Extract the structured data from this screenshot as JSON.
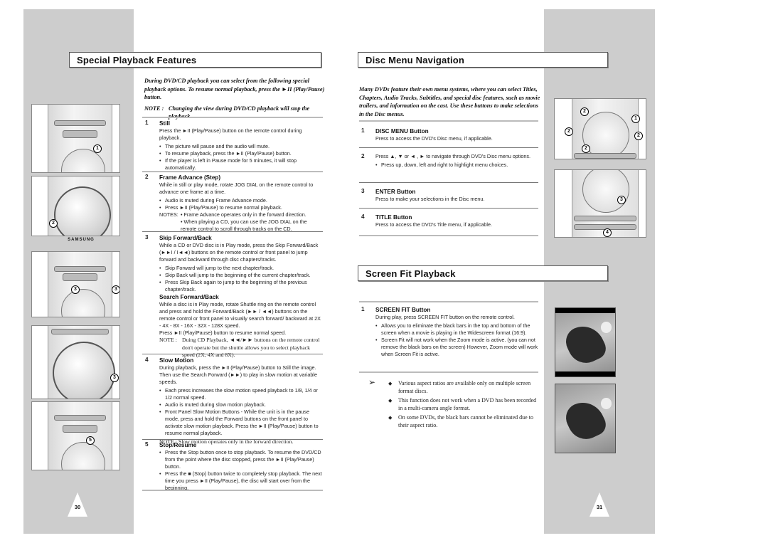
{
  "left_page": {
    "title": "Special Playback Features",
    "intro": "During DVD/CD playback you can select from the following special playback options. To resume normal playback, press the ►II (Play/Pause) button.",
    "note_label": "NOTE :",
    "note_text": "Changing the view during DVD/CD playback will stop the playback.",
    "items": [
      {
        "num": "1",
        "heading": "Still",
        "text": "Press the ►II (Play/Pause) button on the remote control during playback.",
        "bullets": [
          "The picture will pause and the audio will mute.",
          "To resume playback, press the ►II (Play/Pause) button.",
          "If the player is left in Pause mode for 5 minutes, it will stop automatically."
        ]
      },
      {
        "num": "2",
        "heading": "Frame Advance (Step)",
        "text": "While in still or play mode, rotate JOG DIAL on the remote control to advance one frame at a time.",
        "bullets": [
          "Audio is muted during Frame Advance mode.",
          "Press ►II (Play/Pause) to resume normal playback."
        ],
        "notes_label": "NOTES:",
        "notes": [
          "• Frame Advance operates only in the forward direction.",
          "• When playing a CD, you can use the JOG DIAL on the remote control to scroll through tracks on the CD."
        ]
      },
      {
        "num": "3",
        "heading": "Skip Forward/Back",
        "text": "While a CD or DVD disc is in Play mode, press the Skip Forward/Back (►►I / I◄◄) buttons on the remote control or front panel to jump forward and backward through disc chapters/tracks.",
        "bullets": [
          "Skip Forward will jump to the next chapter/track.",
          "Skip Back will jump to the beginning of the current chapter/track.",
          "Press Skip Back again to jump to the beginning of the previous chapter/track."
        ],
        "sub_heading": "Search Forward/Back",
        "sub_text": "While a disc is in Play mode, rotate Shuttle ring on the remote control and press and hold the Forward/Back (►► / ◄◄) buttons on the remote control or front panel to visually search forward/ backward at 2X - 4X - 8X - 16X - 32X - 128X speed.",
        "sub_text2": "Press ►II (Play/Pause) button to resume normal speed.",
        "note_label": "NOTE :",
        "note_text": "Duing CD Playback, ◄◄/►► buttons on the remote control don't operate but the shuttle allows you to select playback speed (2X, 4X and 8X)."
      },
      {
        "num": "4",
        "heading": "Slow Motion",
        "text": "During playback, press the ►II (Play/Pause) button to Still the image. Then use the Search Forward (►►) to play in slow motion at variable speeds.",
        "bullets": [
          "Each press increases the slow motion speed playback to 1/8, 1/4 or 1/2 normal speed.",
          "Audio is muted during slow motion playback.",
          "Front Panel Slow Motion Buttons - While the unit is in the pause mode, press and hold the Forward buttons on the front panel to activate slow motion playback. Press the ►II (Play/Pause) button to resume normal playback."
        ],
        "note_text": "NOTE : Slow motion operates only in the forward direction."
      },
      {
        "num": "5",
        "heading": "Stop/Resume",
        "bullets": [
          "Press the Stop button once to stop playback. To resume the DVD/CD from the point where the disc stopped, press the ►II (Play/Pause) button.",
          "Press the ■ (Stop) button twice to completely stop playback. The next time you press ►II (Play/Pause), the disc will start over from the beginning."
        ]
      }
    ],
    "illustrations": [
      {
        "name": "remote-play-pause",
        "callouts": [
          "1"
        ]
      },
      {
        "name": "remote-jog-dial",
        "callouts": [
          "2"
        ]
      },
      {
        "name": "remote-skip-buttons",
        "callouts": [
          "3",
          "3"
        ]
      },
      {
        "name": "remote-shuttle-ring",
        "callouts": [
          "3"
        ]
      },
      {
        "name": "remote-stop-button",
        "callouts": [
          "5"
        ]
      }
    ],
    "brand": "SAMSUNG",
    "page_number": "30"
  },
  "right_page": {
    "disc_menu": {
      "title": "Disc Menu Navigation",
      "intro": "Many DVDs feature their own menu systems, where you can select Titles, Chapters, Audio Tracks, Subtitles, and special disc features, such as movie trailers, and information on the cast. Use these buttons to make selections in the Disc menus.",
      "items": [
        {
          "num": "1",
          "heading": "DISC MENU Button",
          "text": "Press to access the DVD's Disc menu, if applicable."
        },
        {
          "num": "2",
          "text": "Press ▲, ▼ or ◄ , ► to navigate through DVD's Disc menu options.",
          "bullets": [
            "Press up, down, left and right to highlight menu choices."
          ]
        },
        {
          "num": "3",
          "heading": "ENTER Button",
          "text": "Press to make your selections in the Disc menu."
        },
        {
          "num": "4",
          "heading": "TITLE Button",
          "text": "Press to access the DVD's Title menu, if applicable."
        }
      ],
      "illustrations": [
        {
          "name": "remote-disc-menu-nav",
          "callouts": [
            "1",
            "2",
            "2",
            "2",
            "2"
          ]
        },
        {
          "name": "remote-enter-title",
          "callouts": [
            "3",
            "4"
          ]
        }
      ]
    },
    "screen_fit": {
      "title": "Screen Fit Playback",
      "items": [
        {
          "num": "1",
          "heading": "SCREEN FIT Button",
          "text": "During play, press SCREEN FIT button on the remote control.",
          "bullets": [
            "Allows you to eliminate the black bars in the top and bottom of the screen when a movie is playing in the Widescreen format (16:9).",
            "Screen Fit will not work when the Zoom mode is active. (you can not remove the black bars on the screen) However, Zoom mode will work when Screen Fit is active."
          ]
        }
      ],
      "tips": [
        "Various aspect ratios are available only on multiple screen format discs.",
        "This function does not work when a DVD has been recorded in a multi-camera angle format.",
        "On some DVDs, the black bars cannot be eliminated due to their aspect ratio."
      ],
      "tip_arrow": "➢",
      "photos": [
        {
          "name": "letterbox-photo",
          "caption": ""
        },
        {
          "name": "screen-fit-photo",
          "caption": ""
        }
      ]
    },
    "page_number": "31"
  }
}
